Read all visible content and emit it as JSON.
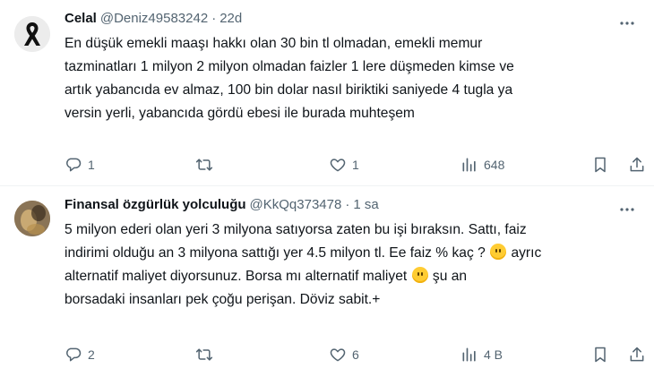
{
  "tweets": [
    {
      "name": "Celal",
      "handle": "@Deniz49583242",
      "separator": "·",
      "time": "22d",
      "lines": [
        "En düşük emekli maaşı hakkı olan 30 bin tl olmadan, emekli memur",
        "tazminatları 1 milyon 2 milyon olmadan faizler 1 lere düşmeden kimse ve",
        "artık yabancıda ev almaz, 100 bin dolar nasıl biriktiki saniyede 4 tugla ya",
        "versin yerli, yabancıda gördü ebesi ile burada muhteşem"
      ],
      "replies": "1",
      "retweets": "",
      "likes": "1",
      "views": "648"
    },
    {
      "name": "Finansal özgürlük yolculuğu",
      "handle": "@KkQq373478",
      "separator": "·",
      "time": "1 sa",
      "line1": "5 milyon ederi olan yeri 3 milyona satıyorsa zaten bu işi bıraksın. Sattı, faiz",
      "line2a": "indirimi olduğu an 3 milyona sattığı yer 4.5 milyon tl. Ee faiz % kaç ?",
      "line2b": "ayrıc",
      "line3a": "alternatif maliyet diyorsunuz. Borsa mı alternatif maliyet",
      "line3b": "şu an",
      "line4": "borsadaki insanları pek çoğu perişan. Döviz sabit.+",
      "replies": "2",
      "retweets": "",
      "likes": "6",
      "views": "4 B"
    }
  ],
  "icons": {
    "avatar1": "black-ribbon-icon",
    "emoji": "smiling-face-emoji",
    "actions": [
      "reply-icon",
      "retweet-icon",
      "like-icon",
      "views-icon",
      "bookmark-icon",
      "share-icon",
      "more-icon"
    ]
  },
  "colors": {
    "text": "#0f1419",
    "secondary": "#536471",
    "divider": "#eff3f4"
  }
}
